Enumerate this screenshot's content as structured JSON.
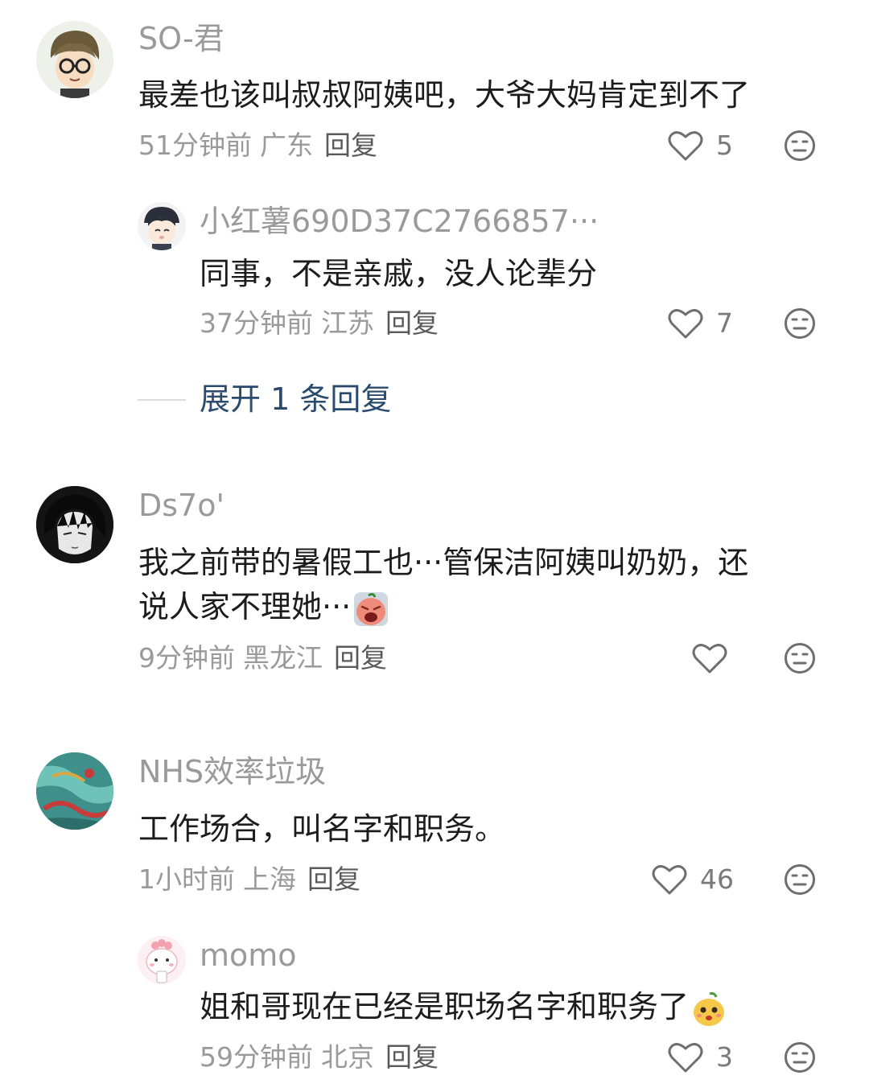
{
  "comments": [
    {
      "username": "SO-君",
      "text": "最差也该叫叔叔阿姨吧，大爷大妈肯定到不了",
      "time": "51分钟前",
      "location": "广东",
      "reply_label": "回复",
      "likes": "5",
      "avatar_icon": "cartoon-glasses-boy-avatar",
      "replies": [
        {
          "username": "小红薯690D37C2766857···",
          "text": "同事，不是亲戚，没人论辈分",
          "time": "37分钟前",
          "location": "江苏",
          "reply_label": "回复",
          "likes": "7",
          "avatar_icon": "anime-cap-avatar"
        }
      ],
      "expand_label": "展开 1 条回复"
    },
    {
      "username": "Ds7o'",
      "text_line1": "我之前带的暑假工也···管保洁阿姨叫奶奶，还",
      "text_line2": "说人家不理她···",
      "emoji": "crying-face-emoji",
      "time": "9分钟前",
      "location": "黑龙江",
      "reply_label": "回复",
      "likes": "",
      "avatar_icon": "anime-dark-hair-avatar"
    },
    {
      "username": "NHS效率垃圾",
      "text": "工作场合，叫名字和职务。",
      "time": "1小时前",
      "location": "上海",
      "reply_label": "回复",
      "likes": "46",
      "avatar_icon": "teal-dragon-art-avatar",
      "replies": [
        {
          "username": "momo",
          "text": "姐和哥现在已经是职场名字和职务了",
          "emoji": "yellow-pear-emoji",
          "time": "59分钟前",
          "location": "北京",
          "reply_label": "回复",
          "likes": "3",
          "avatar_icon": "pink-bunny-avatar"
        }
      ]
    }
  ],
  "colors": {
    "username": "#9a9a9a",
    "text": "#1c1c1c",
    "meta": "#9a9a9a",
    "expand": "#2b4b6e",
    "icon_stroke": "#6e6e6e"
  }
}
